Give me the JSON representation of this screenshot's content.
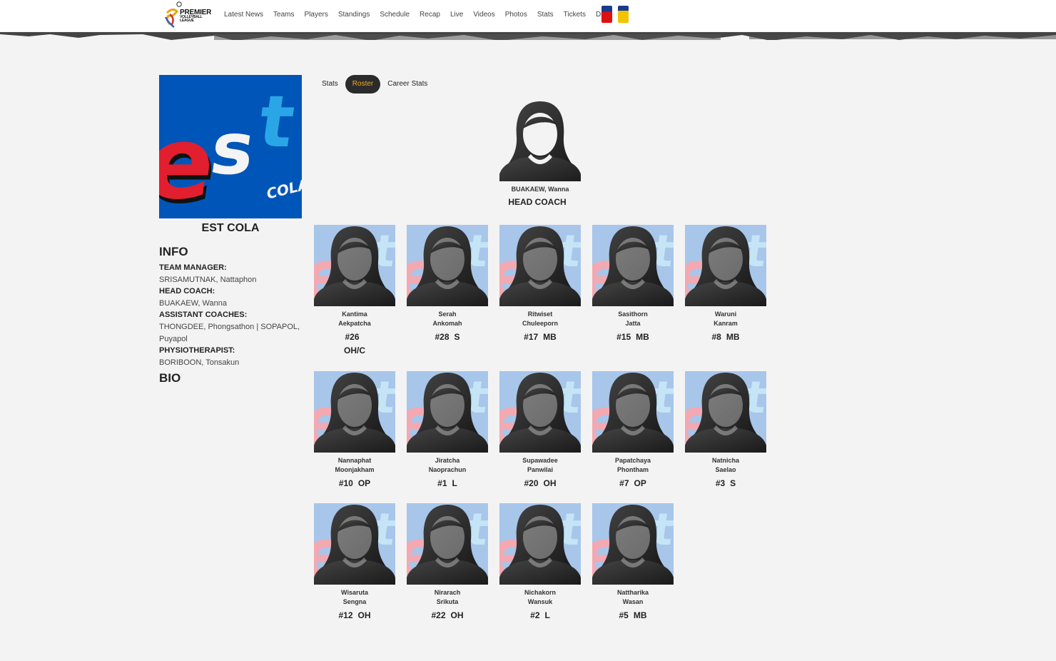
{
  "header": {
    "logo": {
      "line1": "PREMIER",
      "line2": "VOLLEYBALL",
      "line3": "LEAGUE"
    },
    "nav": [
      "Latest News",
      "Teams",
      "Players",
      "Standings",
      "Schedule",
      "Recap",
      "Live",
      "Videos",
      "Photos",
      "Stats",
      "Tickets",
      "Draft"
    ]
  },
  "team": {
    "logo_text_main": "est",
    "logo_text_sub": "COLA",
    "name": "EST COLA",
    "info_heading": "INFO",
    "bio_heading": "BIO",
    "team_manager_label": "TEAM MANAGER:",
    "team_manager": "SRISAMUTNAK, Nattaphon",
    "head_coach_label": "HEAD COACH:",
    "head_coach": "BUAKAEW, Wanna",
    "assistant_coaches_label": "ASSISTANT COACHES:",
    "assistant_coaches": "THONGDEE, Phongsathon | SOPAPOL, Puyapol",
    "physiotherapist_label": "PHYSIOTHERAPIST:",
    "physiotherapist": "BORIBOON, Tonsakun"
  },
  "tabs": [
    "Stats",
    "Roster",
    "Career Stats"
  ],
  "active_tab": "Roster",
  "coach": {
    "name": "BUAKAEW, Wanna",
    "role": "HEAD COACH"
  },
  "players": [
    {
      "first": "Kantima",
      "last": "Aekpatcha",
      "number": "#26",
      "position": "OH/C"
    },
    {
      "first": "Serah",
      "last": "Ankomah",
      "number": "#28",
      "position": "S"
    },
    {
      "first": "Ritwiset",
      "last": "Chuleeporn",
      "number": "#17",
      "position": "MB"
    },
    {
      "first": "Sasithorn",
      "last": "Jatta",
      "number": "#15",
      "position": "MB"
    },
    {
      "first": "Waruni",
      "last": "Kanram",
      "number": "#8",
      "position": "MB"
    },
    {
      "first": "Nannaphat",
      "last": "Moonjakham",
      "number": "#10",
      "position": "OP"
    },
    {
      "first": "Jiratcha",
      "last": "Naoprachun",
      "number": "#1",
      "position": "L"
    },
    {
      "first": "Supawadee",
      "last": "Panwilai",
      "number": "#20",
      "position": "OH"
    },
    {
      "first": "Papatchaya",
      "last": "Phontham",
      "number": "#7",
      "position": "OP"
    },
    {
      "first": "Natnicha",
      "last": "Saelao",
      "number": "#3",
      "position": "S"
    },
    {
      "first": "Wisaruta",
      "last": "Sengna",
      "number": "#12",
      "position": "OH"
    },
    {
      "first": "Nirarach",
      "last": "Srikuta",
      "number": "#22",
      "position": "OH"
    },
    {
      "first": "Nichakorn",
      "last": "Wansuk",
      "number": "#2",
      "position": "L"
    },
    {
      "first": "Nattharika",
      "last": "Wasan",
      "number": "#5",
      "position": "MB"
    }
  ],
  "colors": {
    "brand_blue": "#0055b8",
    "brand_red": "#e11f2f",
    "tab_active_bg": "#2b2b2b",
    "tab_active_text": "#f0a928",
    "page_bg": "#f3f3f3"
  }
}
